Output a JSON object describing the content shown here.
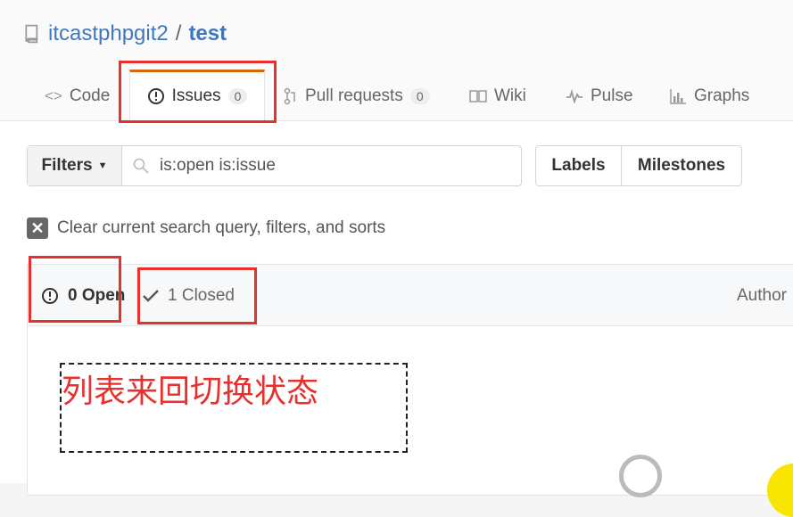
{
  "repo": {
    "owner": "itcastphpgit2",
    "separator": "/",
    "name": "test"
  },
  "tabs": [
    {
      "label": "Code",
      "icon": "code-icon"
    },
    {
      "label": "Issues",
      "icon": "issue-opened-icon",
      "count": "0"
    },
    {
      "label": "Pull requests",
      "icon": "git-pull-request-icon",
      "count": "0"
    },
    {
      "label": "Wiki",
      "icon": "book-icon"
    },
    {
      "label": "Pulse",
      "icon": "pulse-icon"
    },
    {
      "label": "Graphs",
      "icon": "graph-icon"
    }
  ],
  "filters": {
    "label": "Filters",
    "search_value": "is:open is:issue"
  },
  "buttons": {
    "labels": "Labels",
    "milestones": "Milestones"
  },
  "clear": {
    "label": "Clear current search query, filters, and sorts"
  },
  "states": {
    "open": "0 Open",
    "closed": "1 Closed"
  },
  "list_header": {
    "author": "Author"
  },
  "annotation": {
    "text": "列表来回切换状态"
  },
  "colors": {
    "accent": "#d26911",
    "link": "#4078c0",
    "highlight": "#e8312f"
  }
}
